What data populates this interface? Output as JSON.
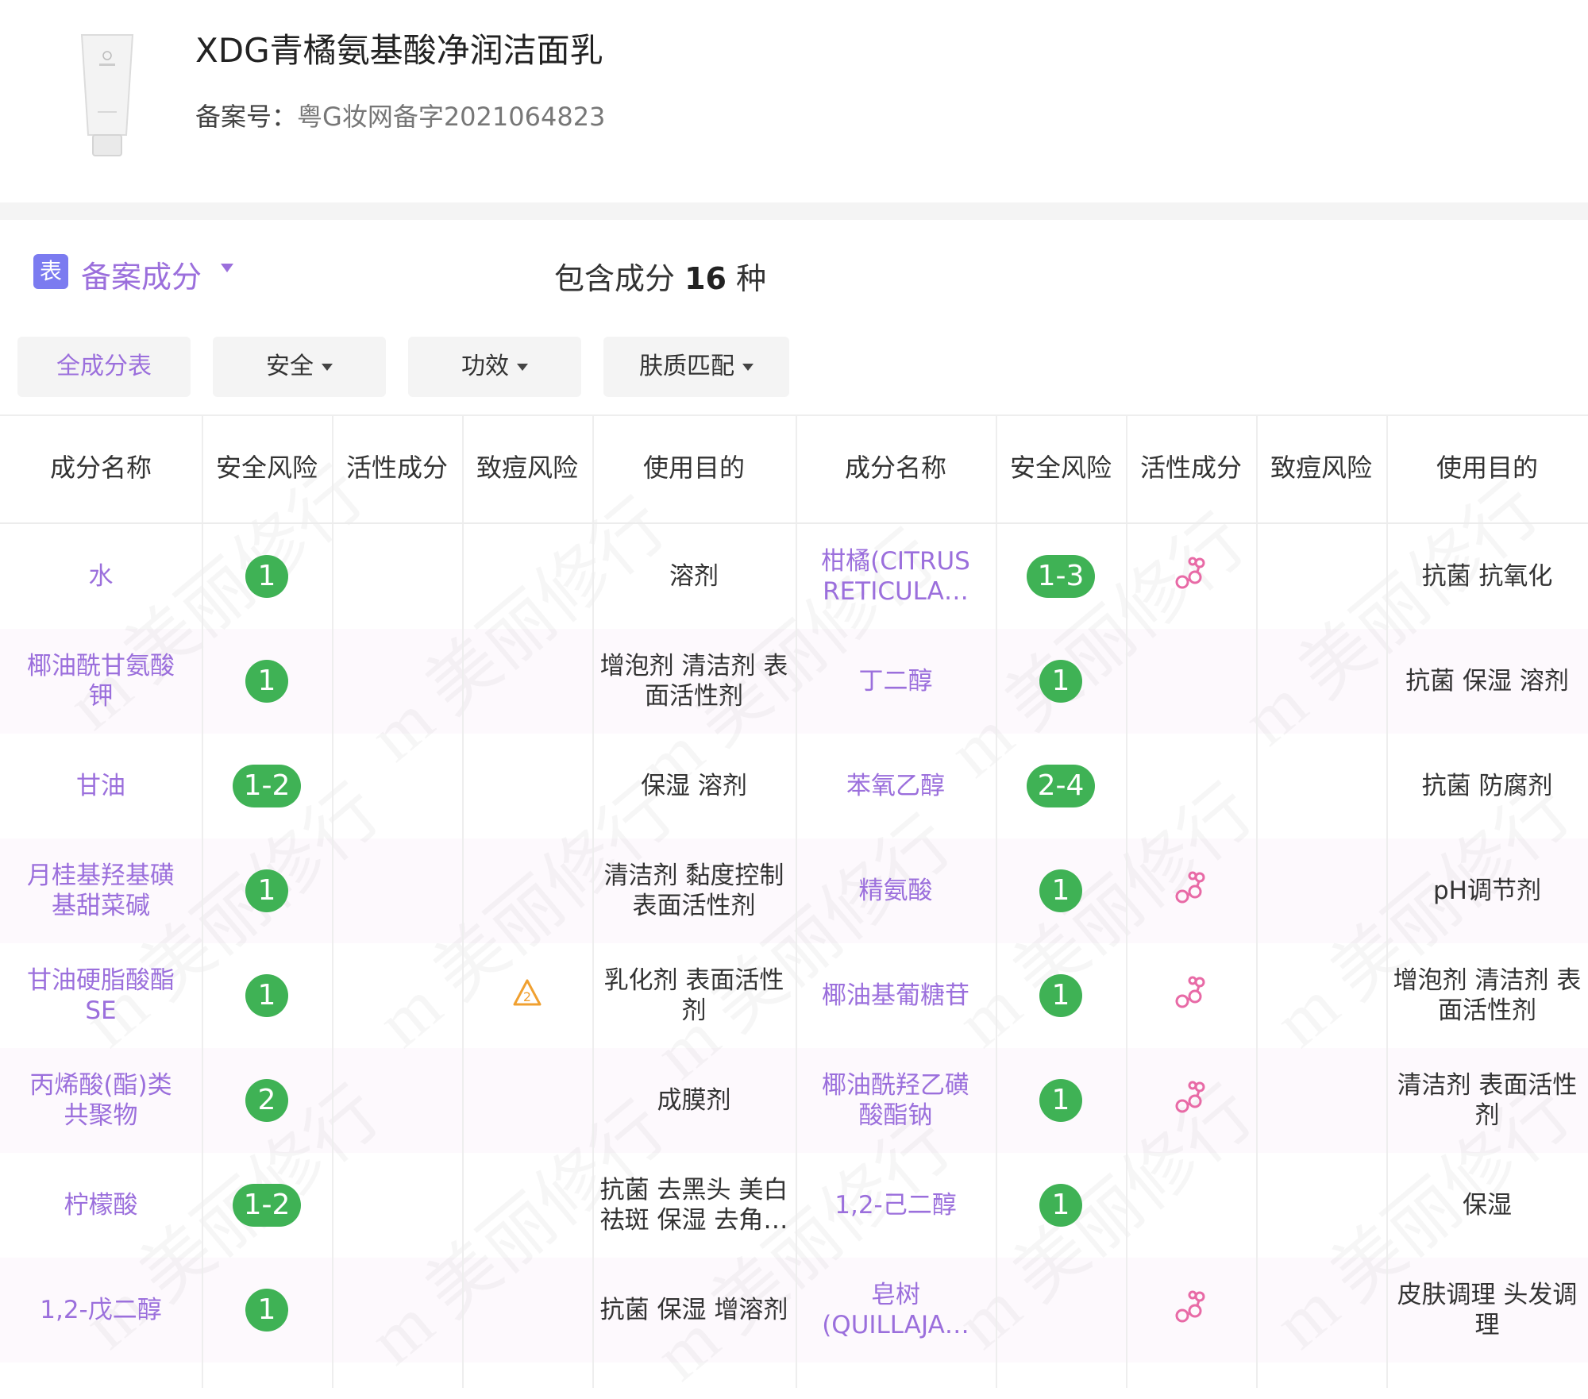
{
  "product": {
    "title": "XDG青橘氨基酸净润洁面乳",
    "registration_label": "备案号：",
    "registration_value": "粤G妆网备字2021064823"
  },
  "section": {
    "icon_text": "表",
    "title": "备案成分",
    "count_prefix": "包含成分",
    "count_value": "16",
    "count_suffix": "种"
  },
  "filters": [
    "全成分表",
    "安全",
    "功效",
    "肤质匹配"
  ],
  "columns": [
    "成分名称",
    "安全风险",
    "活性成分",
    "致痘风险",
    "使用目的"
  ],
  "left_rows": [
    {
      "name": [
        "水"
      ],
      "risk": "1",
      "active": false,
      "acne": "",
      "purpose": [
        "溶剂"
      ]
    },
    {
      "name": [
        "椰油酰甘氨酸",
        "钾"
      ],
      "risk": "1",
      "active": false,
      "acne": "",
      "purpose": [
        "增泡剂 清洁剂 表",
        "面活性剂"
      ]
    },
    {
      "name": [
        "甘油"
      ],
      "risk": "1-2",
      "active": false,
      "acne": "",
      "purpose": [
        "保湿 溶剂"
      ]
    },
    {
      "name": [
        "月桂基羟基磺",
        "基甜菜碱"
      ],
      "risk": "1",
      "active": false,
      "acne": "",
      "purpose": [
        "清洁剂 黏度控制",
        "表面活性剂"
      ]
    },
    {
      "name": [
        "甘油硬脂酸酯",
        "SE"
      ],
      "risk": "1",
      "active": false,
      "acne": "2",
      "purpose": [
        "乳化剂 表面活性",
        "剂"
      ]
    },
    {
      "name": [
        "丙烯酸(酯)类",
        "共聚物"
      ],
      "risk": "2",
      "active": false,
      "acne": "",
      "purpose": [
        "成膜剂"
      ]
    },
    {
      "name": [
        "柠檬酸"
      ],
      "risk": "1-2",
      "active": false,
      "acne": "",
      "purpose": [
        "抗菌 去黑头 美白",
        "祛斑 保湿 去角…"
      ]
    },
    {
      "name": [
        "1,2-戊二醇"
      ],
      "risk": "1",
      "active": false,
      "acne": "",
      "purpose": [
        "抗菌 保湿 增溶剂"
      ]
    }
  ],
  "right_rows": [
    {
      "name": [
        "柑橘(CITRUS",
        "RETICULA…"
      ],
      "risk": "1-3",
      "active": true,
      "acne": "",
      "purpose": [
        "抗菌 抗氧化"
      ]
    },
    {
      "name": [
        "丁二醇"
      ],
      "risk": "1",
      "active": false,
      "acne": "",
      "purpose": [
        "抗菌 保湿 溶剂"
      ]
    },
    {
      "name": [
        "苯氧乙醇"
      ],
      "risk": "2-4",
      "active": false,
      "acne": "",
      "purpose": [
        "抗菌 防腐剂"
      ]
    },
    {
      "name": [
        "精氨酸"
      ],
      "risk": "1",
      "active": true,
      "acne": "",
      "purpose": [
        "pH调节剂"
      ]
    },
    {
      "name": [
        "椰油基葡糖苷"
      ],
      "risk": "1",
      "active": true,
      "acne": "",
      "purpose": [
        "增泡剂 清洁剂 表",
        "面活性剂"
      ]
    },
    {
      "name": [
        "椰油酰羟乙磺",
        "酸酯钠"
      ],
      "risk": "1",
      "active": true,
      "acne": "",
      "purpose": [
        "清洁剂 表面活性",
        "剂"
      ]
    },
    {
      "name": [
        "1,2-己二醇"
      ],
      "risk": "1",
      "active": false,
      "acne": "",
      "purpose": [
        "保湿"
      ]
    },
    {
      "name": [
        "皂树",
        "(QUILLAJA…"
      ],
      "risk": "",
      "active": true,
      "acne": "",
      "purpose": [
        "皮肤调理 头发调",
        "理"
      ]
    }
  ],
  "colors": {
    "accent": "#9b6fdc",
    "safe_badge": "#3fb255",
    "active_icon": "#e86aa6",
    "acne_icon": "#f0a030"
  },
  "icons": {
    "active": "molecule-icon",
    "acne": "warning-triangle-icon",
    "section": "table-icon"
  }
}
